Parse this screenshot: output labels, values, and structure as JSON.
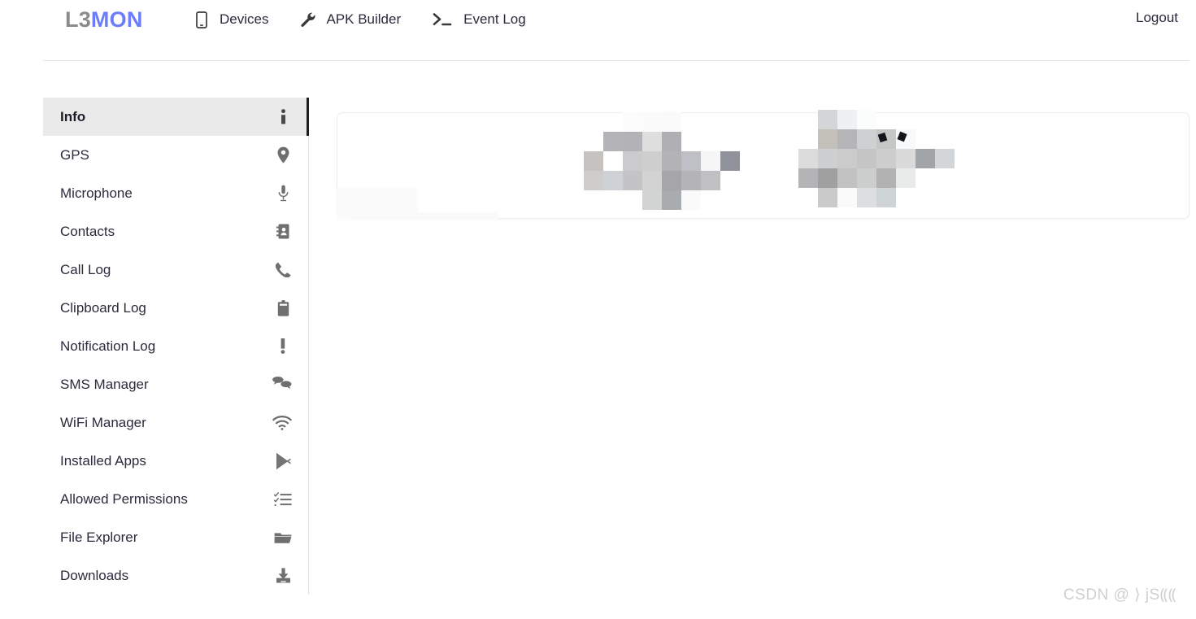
{
  "brand": {
    "part1": "L3",
    "part2": "MON",
    "color1": "#8a8a8a",
    "color2": "#6c7dfb"
  },
  "topnav": {
    "items": [
      {
        "label": "Devices",
        "icon": "mobile-phone-icon"
      },
      {
        "label": "APK Builder",
        "icon": "wrench-icon"
      },
      {
        "label": "Event Log",
        "icon": "terminal-prompt-icon"
      }
    ],
    "logout_label": "Logout"
  },
  "sidebar": {
    "active_index": 0,
    "items": [
      {
        "label": "Info",
        "icon": "info-icon"
      },
      {
        "label": "GPS",
        "icon": "map-pin-icon"
      },
      {
        "label": "Microphone",
        "icon": "microphone-icon"
      },
      {
        "label": "Contacts",
        "icon": "address-book-icon"
      },
      {
        "label": "Call Log",
        "icon": "phone-icon"
      },
      {
        "label": "Clipboard Log",
        "icon": "clipboard-icon"
      },
      {
        "label": "Notification Log",
        "icon": "exclamation-icon"
      },
      {
        "label": "SMS Manager",
        "icon": "chat-bubbles-icon"
      },
      {
        "label": "WiFi Manager",
        "icon": "wifi-icon"
      },
      {
        "label": "Installed Apps",
        "icon": "google-play-icon"
      },
      {
        "label": "Allowed Permissions",
        "icon": "checklist-icon"
      },
      {
        "label": "File Explorer",
        "icon": "folder-icon"
      },
      {
        "label": "Downloads",
        "icon": "download-icon"
      }
    ]
  },
  "main": {
    "card_content": "",
    "censored": true
  },
  "watermark": {
    "text": "CSDN @ ⟩ jS⸨⸨"
  },
  "colors": {
    "accent": "#6c7dfb",
    "active_background": "#eaeaea",
    "active_marker": "#1c1c1c",
    "divider": "#e3e3e3",
    "text": "#2b2b3d",
    "icon": "#6f6f6f",
    "watermark": "#cfcfcf"
  },
  "mosaic_a": [
    [
      "transparent",
      "transparent",
      "#fcfcfc",
      "#fbfbfb",
      "#fafafa",
      "transparent"
    ],
    [
      "transparent",
      "#b4b4b8",
      "#b3b3b7",
      "#dedede",
      "#b0b0b4",
      "transparent"
    ],
    [
      "#c6c2bf",
      "transparent",
      "#cbcbcd",
      "#cecece",
      "#b3b3b5",
      "#bfbfc6",
      "#f6f6f6",
      "#90939b"
    ],
    [
      "#cecdcb",
      "#ced2d6",
      "#c4c4c6",
      "#d2d2d2",
      "#a6a6a8",
      "#b4b4b6",
      "#c0c0c2",
      "transparent"
    ],
    [
      "transparent",
      "transparent",
      "transparent",
      "#d2d4d4",
      "#a9acae",
      "#fafafa",
      "transparent",
      "transparent"
    ]
  ],
  "mosaic_b": [
    [
      "transparent",
      "#d3d6d6",
      "#eef1f2",
      "#fbfcfc",
      "transparent",
      "transparent",
      "transparent"
    ],
    [
      "transparent",
      "#c3c0ba",
      "#b5b5b8",
      "#cfd0d1",
      "#c5c7c7",
      "#f7f9fa",
      "transparent"
    ],
    [
      "#dcdcdc",
      "#cdcfd0",
      "#cbcbcb",
      "#c5c5c5",
      "#cdcdcd",
      "#dadada",
      "#a2a5a8",
      "#d2d6d8"
    ],
    [
      "#b4b4b6",
      "#a0a0a0",
      "#c2c2c2",
      "#cccece",
      "#b2b2b2",
      "#e9eaea",
      "transparent",
      "transparent"
    ],
    [
      "transparent",
      "#cacaca",
      "#fafafa",
      "#dcdedf",
      "#cfd4d4",
      "transparent",
      "transparent"
    ]
  ]
}
